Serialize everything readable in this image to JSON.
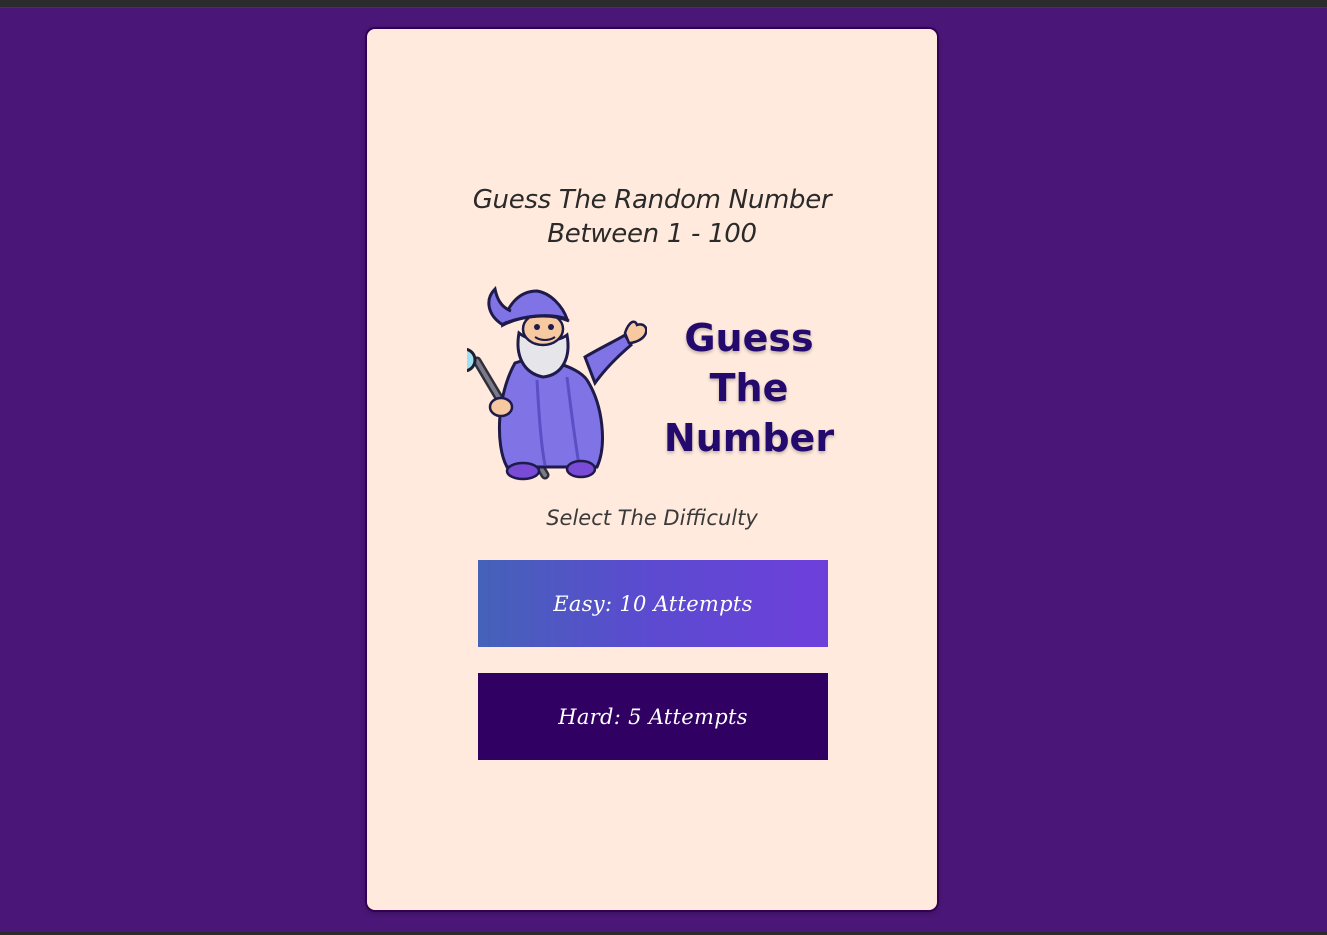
{
  "game": {
    "subtitle_line1": "Guess The Random Number",
    "subtitle_line2": "Between 1 - 100",
    "title_line1": "Guess",
    "title_line2": "The",
    "title_line3": "Number",
    "difficulty_prompt": "Select The Difficulty"
  },
  "buttons": {
    "easy_label": "Easy: 10 Attempts",
    "hard_label": "Hard: 5 Attempts"
  },
  "theme": {
    "page_background": "#4a1677",
    "card_background": "#ffeadd",
    "title_color": "#250a6e",
    "easy_gradient_start": "#4562b8",
    "easy_gradient_end": "#6e3fdb",
    "hard_button": "#300062"
  },
  "icons": {
    "mascot": "wizard-mascot-icon"
  }
}
